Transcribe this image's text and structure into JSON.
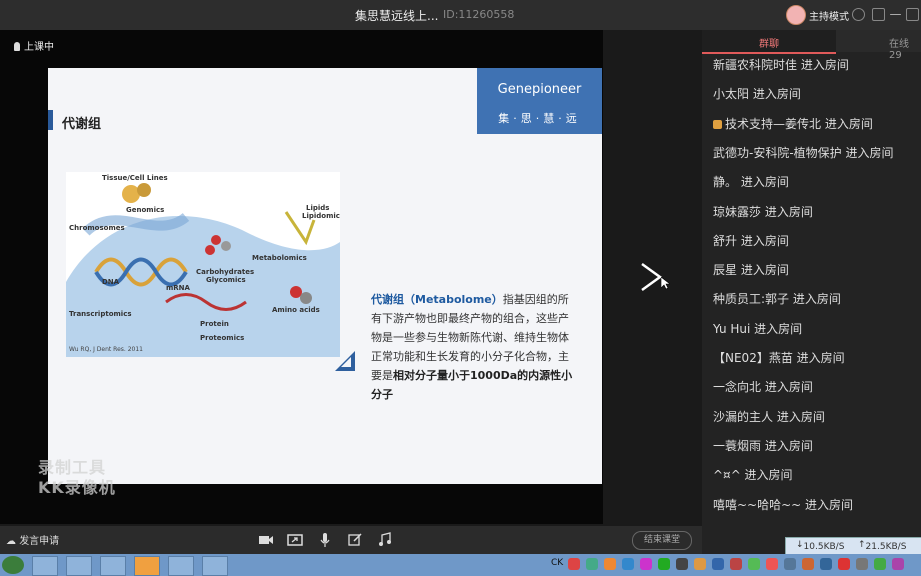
{
  "window": {
    "title": "集思慧远线上...",
    "meeting_id": "ID:11260558",
    "host_label": "主持模式"
  },
  "stage": {
    "live_label": "上课中"
  },
  "slide": {
    "heading": "代谢组",
    "logo_en": "Genepioneer",
    "logo_zh": "集·思·慧·远",
    "figure_labels": [
      "Tissue/Cell Lines",
      "Genomics",
      "Chromosomes",
      "DNA",
      "mRNA",
      "Transcriptomics",
      "Carbohydrates",
      "Glycomics",
      "Metabolomics",
      "Lipids",
      "Lipidomics",
      "Amino acids",
      "Protein",
      "Proteomics"
    ],
    "figure_cite": "Wu RQ, J Dent Res. 2011",
    "para_term": "代谢组（Metabolome）",
    "para_text": "指基因组的所有下游产物也即最终产物的组合，这些产物是一些参与生物新陈代谢、维持生物体正常功能和生长发育的小分子化合物，主要是",
    "para_bold": "相对分子量小于1000Da的内源性小分子"
  },
  "watermark": {
    "line1": "录制工具",
    "line2": "KK录像机"
  },
  "bottombar": {
    "apply_label": "发言申请",
    "end_label": "结束课堂"
  },
  "sidebar": {
    "tab_chat": "群聊",
    "tab_online": "在线29",
    "messages": [
      "新疆农科院时佳 进入房间",
      "小太阳 进入房间",
      "技术支持—姜传北 进入房间",
      "武德功-安科院-植物保护 进入房间",
      "静。 进入房间",
      "琼妹露莎 进入房间",
      "舒升 进入房间",
      "辰星 进入房间",
      "种质员工:郭子 进入房间",
      "Yu Hui 进入房间",
      "【NE02】燕苗 进入房间",
      "一念向北 进入房间",
      "沙漏的主人 进入房间",
      "一蓑烟雨 进入房间",
      "^¤^ 进入房间",
      "嘻嘻~~哈哈~~ 进入房间"
    ]
  },
  "network": {
    "down": "10.5KB/S",
    "up": "21.5KB/S"
  },
  "taskbar": {
    "tray_text": "CK"
  }
}
